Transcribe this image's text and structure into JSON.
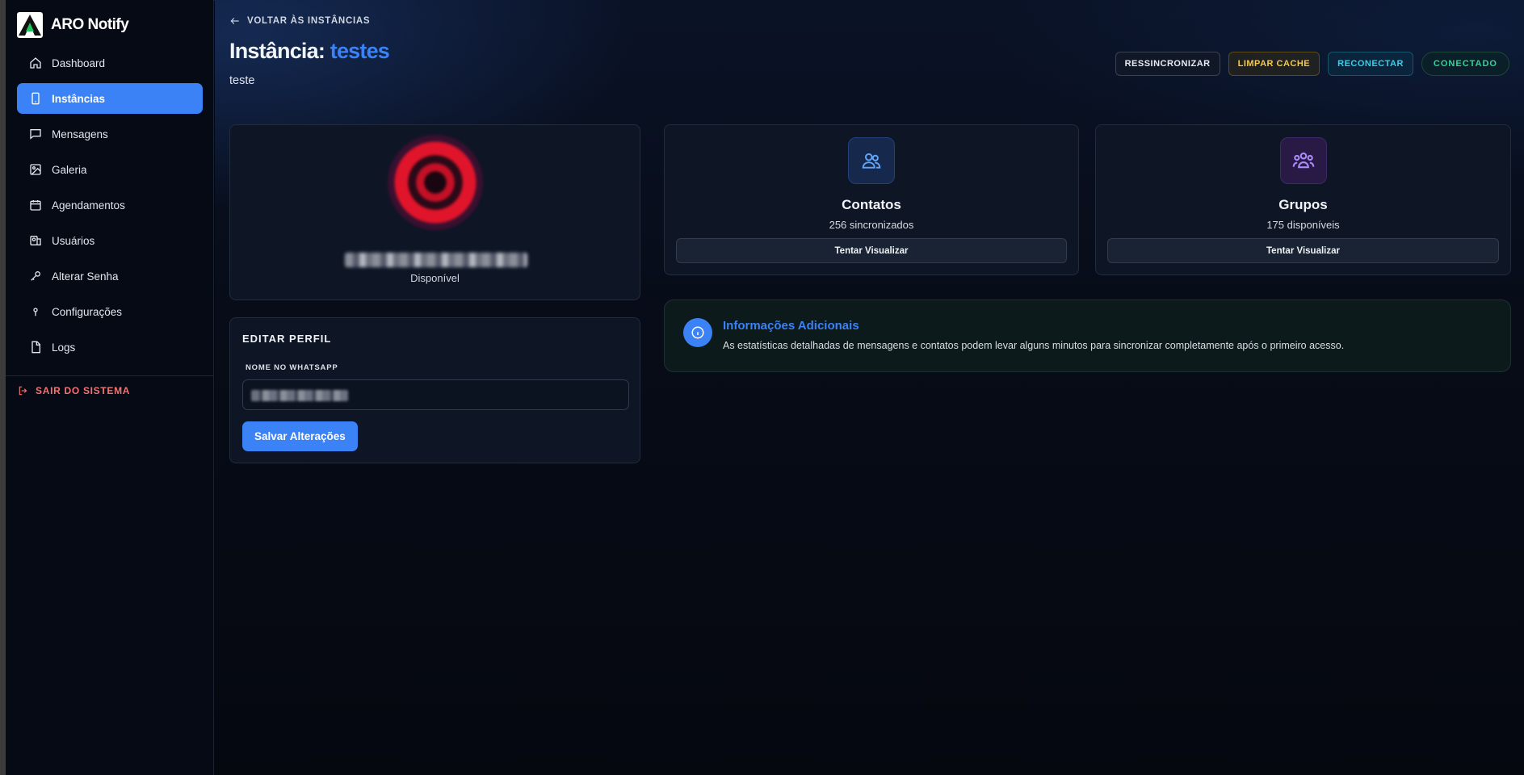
{
  "app": {
    "name": "ARO Notify"
  },
  "sidebar": {
    "items": [
      {
        "label": "Dashboard",
        "icon": "home-icon",
        "active": false
      },
      {
        "label": "Instâncias",
        "icon": "smartphone-icon",
        "active": true
      },
      {
        "label": "Mensagens",
        "icon": "message-icon",
        "active": false
      },
      {
        "label": "Galeria",
        "icon": "image-icon",
        "active": false
      },
      {
        "label": "Agendamentos",
        "icon": "calendar-icon",
        "active": false
      },
      {
        "label": "Usuários",
        "icon": "users-icon",
        "active": false
      },
      {
        "label": "Alterar Senha",
        "icon": "key-icon",
        "active": false
      },
      {
        "label": "Configurações",
        "icon": "settings-icon",
        "active": false
      },
      {
        "label": "Logs",
        "icon": "file-icon",
        "active": false
      }
    ],
    "logout_label": "SAIR DO SISTEMA"
  },
  "header": {
    "back_label": "VOLTAR ÀS INSTÂNCIAS",
    "title_prefix": "Instância:",
    "title_name": "testes",
    "subtitle": "teste",
    "actions": {
      "resync": "RESSINCRONIZAR",
      "clear_cache": "LIMPAR CACHE",
      "reconnect": "RECONECTAR",
      "status": "CONECTADO"
    }
  },
  "profile": {
    "status": "Disponível"
  },
  "edit_profile": {
    "title": "EDITAR PERFIL",
    "field_label": "NOME NO WHATSAPP",
    "save_label": "Salvar Alterações"
  },
  "stats": {
    "contacts": {
      "title": "Contatos",
      "subtitle": "256 sincronizados",
      "button": "Tentar Visualizar"
    },
    "groups": {
      "title": "Grupos",
      "subtitle": "175 disponíveis",
      "button": "Tentar Visualizar"
    }
  },
  "info": {
    "title": "Informações Adicionais",
    "text": "As estatísticas detalhadas de mensagens e contatos podem levar alguns minutos para sincronizar completamente após o primeiro acesso."
  },
  "colors": {
    "accent": "#3b82f6",
    "success": "#34d399",
    "warning": "#f7c948",
    "cyan": "#35d0ea",
    "danger": "#f87171",
    "purple": "#a78bfa"
  }
}
